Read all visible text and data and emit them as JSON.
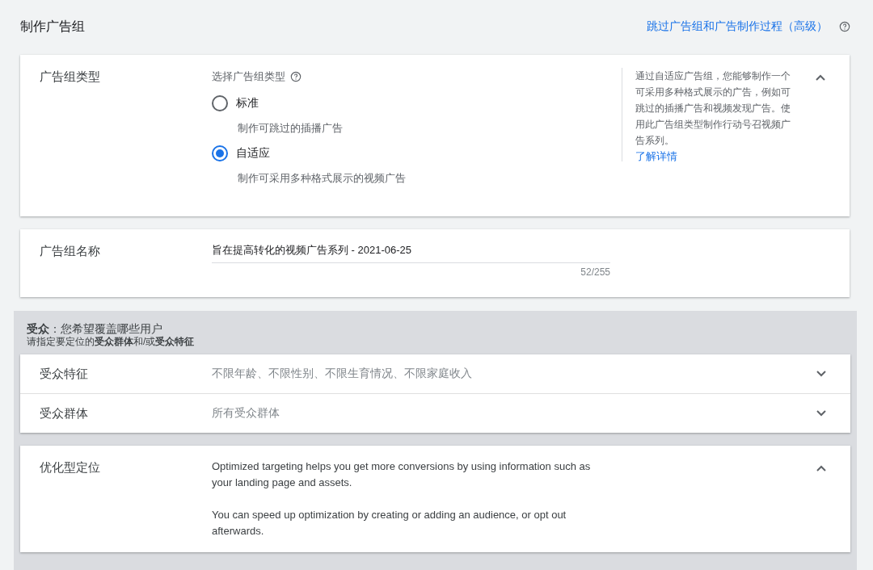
{
  "header": {
    "title": "制作广告组",
    "skip_link": "跳过广告组和广告制作过程（高级）"
  },
  "ad_group_type": {
    "label": "广告组类型",
    "prompt": "选择广告组类型",
    "expanded": true,
    "options": [
      {
        "label": "标准",
        "description": "制作可跳过的插播广告",
        "selected": false
      },
      {
        "label": "自适应",
        "description": "制作可采用多种格式展示的视频广告",
        "selected": true
      }
    ],
    "help_text": "通过自适应广告组，您能够制作一个可采用多种格式展示的广告，例如可跳过的插播广告和视频发现广告。使用此广告组类型制作行动号召视频广告系列。",
    "help_link": "了解详情"
  },
  "ad_group_name": {
    "label": "广告组名称",
    "value": "旨在提高转化的视频广告系列 - 2021-06-25",
    "counter": "52/255"
  },
  "audience": {
    "heading": "**受众**：您希望覆盖哪些用户",
    "subheading": "请指定要定位的**受众群体**和/或**受众特征**",
    "rows": [
      {
        "label": "受众特征",
        "summary": "不限年龄、不限性别、不限生育情况、不限家庭收入",
        "expanded": false
      },
      {
        "label": "受众群体",
        "summary": "所有受众群体",
        "expanded": false
      }
    ]
  },
  "optimized_targeting": {
    "label": "优化型定位",
    "expanded": true,
    "paragraphs": [
      "Optimized targeting helps you get more conversions by using information such as your landing page and assets.",
      "You can speed up optimization by creating or adding an audience, or opt out afterwards."
    ]
  }
}
